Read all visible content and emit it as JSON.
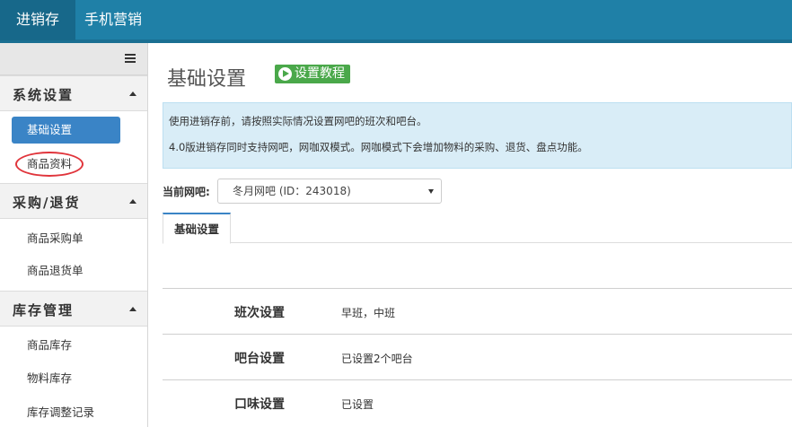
{
  "topnav": {
    "tabs": [
      {
        "label": "进销存",
        "active": true
      },
      {
        "label": "手机营销",
        "active": false
      }
    ]
  },
  "sidebar": {
    "toggle_icon": "hamburger-icon",
    "sections": [
      {
        "label": "系统设置",
        "items": [
          "基础设置",
          "商品资料"
        ]
      },
      {
        "label": "采购/退货",
        "items": [
          "商品采购单",
          "商品退货单"
        ]
      },
      {
        "label": "库存管理",
        "items": [
          "商品库存",
          "物料库存",
          "库存调整记录"
        ]
      }
    ],
    "active_item": "基础设置"
  },
  "main": {
    "title": "基础设置",
    "tutorial_label": "设置教程",
    "info_lines": [
      "使用进销存前，请按照实际情况设置网吧的班次和吧台。",
      "4.0版进销存同时支持网吧，网咖双模式。网咖模式下会增加物料的采购、退货、盘点功能。"
    ],
    "current_bar_label": "当前网吧:",
    "current_bar_value": "冬月网吧 (ID：243018)",
    "tab_label": "基础设置",
    "rows": [
      {
        "key": "班次设置",
        "value": "早班，中班"
      },
      {
        "key": "吧台设置",
        "value": "已设置2个吧台"
      },
      {
        "key": "口味设置",
        "value": "已设置"
      }
    ]
  },
  "colors": {
    "topbar": "#1f80a7",
    "active_item": "#3a84c6",
    "tutorial_button": "#4aa84a",
    "info_bg": "#d9edf7",
    "annotation_circle": "#e0343b"
  }
}
